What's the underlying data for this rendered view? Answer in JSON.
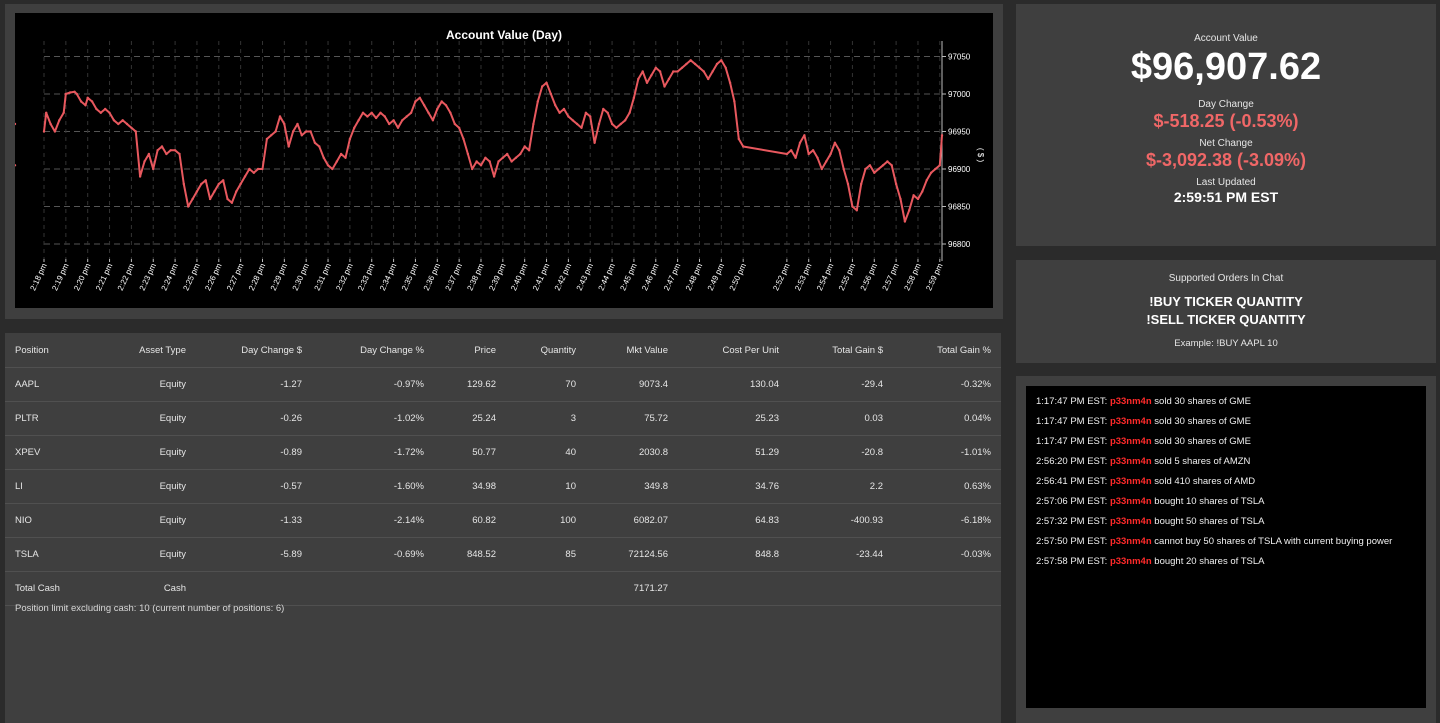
{
  "chart": {
    "title": "Account Value (Day)",
    "y_axis_label": "( $ )"
  },
  "chart_data": {
    "type": "line",
    "title": "Account Value (Day)",
    "ylabel": "( $ )",
    "ylim": [
      96780,
      97060
    ],
    "yticks": [
      96800,
      96850,
      96900,
      96950,
      97000,
      97050
    ],
    "x_tick_labels": [
      "2:18 pm",
      "2:19 pm",
      "2:20 pm",
      "2:21 pm",
      "2:22 pm",
      "2:23 pm",
      "2:24 pm",
      "2:25 pm",
      "2:26 pm",
      "2:27 pm",
      "2:28 pm",
      "2:29 pm",
      "2:30 pm",
      "2:31 pm",
      "2:32 pm",
      "2:33 pm",
      "2:34 pm",
      "2:35 pm",
      "2:36 pm",
      "2:37 pm",
      "2:38 pm",
      "2:39 pm",
      "2:40 pm",
      "2:41 pm",
      "2:42 pm",
      "2:43 pm",
      "2:44 pm",
      "2:45 pm",
      "2:46 pm",
      "2:47 pm",
      "2:48 pm",
      "2:49 pm",
      "2:50 pm",
      "2:52 pm",
      "2:53 pm",
      "2:54 pm",
      "2:55 pm",
      "2:56 pm",
      "2:57 pm",
      "2:58 pm",
      "2:59 pm"
    ],
    "x_tick_minutes": [
      18,
      19,
      20,
      21,
      22,
      23,
      24,
      25,
      26,
      27,
      28,
      29,
      30,
      31,
      32,
      33,
      34,
      35,
      36,
      37,
      38,
      39,
      40,
      41,
      42,
      43,
      44,
      45,
      46,
      47,
      48,
      49,
      50,
      52,
      53,
      54,
      55,
      56,
      57,
      58,
      59
    ],
    "x_minutes": [
      18.0,
      18.1,
      18.3,
      18.5,
      18.7,
      18.9,
      19.0,
      19.2,
      19.4,
      19.5,
      19.7,
      19.9,
      20.0,
      20.2,
      20.4,
      20.6,
      20.8,
      21.0,
      21.2,
      21.4,
      21.6,
      21.8,
      22.0,
      22.2,
      22.4,
      22.6,
      22.8,
      23.0,
      23.2,
      23.4,
      23.6,
      23.8,
      24.0,
      24.2,
      24.4,
      24.6,
      24.8,
      25.0,
      25.2,
      25.4,
      25.6,
      25.8,
      26.0,
      26.2,
      26.4,
      26.6,
      26.8,
      27.0,
      27.2,
      27.4,
      27.6,
      27.8,
      28.0,
      28.2,
      28.4,
      28.6,
      28.8,
      29.0,
      29.2,
      29.4,
      29.6,
      29.8,
      30.0,
      30.2,
      30.4,
      30.6,
      30.8,
      31.0,
      31.2,
      31.4,
      31.6,
      31.8,
      32.0,
      32.2,
      32.4,
      32.6,
      32.8,
      33.0,
      33.2,
      33.4,
      33.6,
      33.8,
      34.0,
      34.2,
      34.4,
      34.6,
      34.8,
      35.0,
      35.2,
      35.4,
      35.6,
      35.8,
      36.0,
      36.2,
      36.4,
      36.6,
      36.8,
      37.0,
      37.2,
      37.4,
      37.6,
      37.8,
      38.0,
      38.2,
      38.4,
      38.6,
      38.8,
      39.0,
      39.2,
      39.4,
      39.6,
      39.8,
      40.0,
      40.2,
      40.4,
      40.6,
      40.8,
      41.0,
      41.2,
      41.4,
      41.6,
      41.8,
      42.0,
      42.2,
      42.4,
      42.6,
      42.8,
      43.0,
      43.2,
      43.4,
      43.6,
      43.8,
      44.0,
      44.2,
      44.4,
      44.6,
      44.8,
      45.0,
      45.2,
      45.4,
      45.6,
      45.8,
      46.0,
      46.2,
      46.4,
      46.6,
      46.8,
      47.0,
      47.2,
      47.4,
      47.6,
      47.8,
      48.0,
      48.2,
      48.4,
      48.6,
      48.8,
      49.0,
      49.2,
      49.4,
      49.6,
      49.8,
      50.0,
      52.0,
      52.2,
      52.4,
      52.6,
      52.8,
      53.0,
      53.2,
      53.4,
      53.6,
      53.8,
      54.0,
      54.2,
      54.4,
      54.6,
      54.8,
      55.0,
      55.2,
      55.4,
      55.6,
      55.8,
      56.0,
      56.2,
      56.4,
      56.6,
      56.8,
      57.0,
      57.2,
      57.4,
      57.6,
      57.8,
      58.0,
      58.2,
      58.4,
      58.6,
      58.8,
      59.0,
      59.1
    ],
    "values": [
      96950,
      96975,
      96960,
      96950,
      96965,
      96975,
      97000,
      97002,
      97003,
      97000,
      96990,
      96985,
      96995,
      96990,
      96980,
      96975,
      96980,
      96975,
      96965,
      96960,
      96965,
      96960,
      96955,
      96950,
      96890,
      96910,
      96920,
      96900,
      96925,
      96930,
      96920,
      96925,
      96925,
      96920,
      96880,
      96850,
      96860,
      96870,
      96880,
      96885,
      96860,
      96870,
      96880,
      96885,
      96860,
      96855,
      96870,
      96880,
      96890,
      96900,
      96895,
      96900,
      96900,
      96940,
      96945,
      96950,
      96970,
      96960,
      96930,
      96950,
      96960,
      96945,
      96950,
      96950,
      96935,
      96930,
      96915,
      96905,
      96900,
      96910,
      96920,
      96915,
      96940,
      96955,
      96965,
      96975,
      96970,
      96975,
      96968,
      96975,
      96970,
      96960,
      96965,
      96955,
      96965,
      96970,
      96975,
      96990,
      96995,
      96985,
      96975,
      96965,
      96980,
      96990,
      96985,
      96975,
      96960,
      96955,
      96940,
      96920,
      96900,
      96910,
      96905,
      96915,
      96910,
      96890,
      96910,
      96915,
      96920,
      96910,
      96915,
      96920,
      96930,
      96925,
      96960,
      96990,
      97010,
      97015,
      97000,
      96985,
      96975,
      96980,
      96970,
      96965,
      96960,
      96955,
      96975,
      96970,
      96935,
      96960,
      96980,
      96975,
      96960,
      96955,
      96960,
      96965,
      96975,
      96995,
      97020,
      97030,
      97015,
      97025,
      97035,
      97030,
      97010,
      97020,
      97030,
      97030,
      97035,
      97040,
      97045,
      97040,
      97035,
      97030,
      97020,
      97030,
      97040,
      97045,
      97035,
      97015,
      96990,
      96940,
      96930,
      96920,
      96925,
      96915,
      96935,
      96945,
      96920,
      96925,
      96915,
      96900,
      96910,
      96920,
      96935,
      96925,
      96900,
      96880,
      96850,
      96845,
      96880,
      96900,
      96905,
      96895,
      96900,
      96905,
      96910,
      96905,
      96880,
      96860,
      96830,
      96845,
      96865,
      96860,
      96870,
      96885,
      96895,
      96900,
      96905,
      96945,
      96960,
      96905
    ],
    "grid": true,
    "legend": "none"
  },
  "summary": {
    "account_value_label": "Account Value",
    "account_value": "$96,907.62",
    "day_change_label": "Day Change",
    "day_change": "$-518.25 (-0.53%)",
    "net_change_label": "Net Change",
    "net_change": "$-3,092.38 (-3.09%)",
    "last_updated_label": "Last Updated",
    "last_updated": "2:59:51 PM EST"
  },
  "orders": {
    "title": "Supported Orders In Chat",
    "buy": "!BUY TICKER QUANTITY",
    "sell": "!SELL TICKER QUANTITY",
    "example": "Example: !BUY AAPL 10"
  },
  "table": {
    "headers": [
      "Position",
      "Asset Type",
      "Day Change $",
      "Day Change %",
      "Price",
      "Quantity",
      "Mkt Value",
      "Cost Per Unit",
      "Total Gain $",
      "Total Gain %"
    ],
    "rows": [
      {
        "position": "AAPL",
        "type": "Equity",
        "day_change": "-1.27",
        "day_change_pct": "-0.97%",
        "price": "129.62",
        "qty": "70",
        "mkt": "9073.4",
        "cost": "130.04",
        "gain": "-29.4",
        "gain_pct": "-0.32%",
        "day_neg": true,
        "gain_neg": true
      },
      {
        "position": "PLTR",
        "type": "Equity",
        "day_change": "-0.26",
        "day_change_pct": "-1.02%",
        "price": "25.24",
        "qty": "3",
        "mkt": "75.72",
        "cost": "25.23",
        "gain": "0.03",
        "gain_pct": "0.04%",
        "day_neg": true,
        "gain_neg": false
      },
      {
        "position": "XPEV",
        "type": "Equity",
        "day_change": "-0.89",
        "day_change_pct": "-1.72%",
        "price": "50.77",
        "qty": "40",
        "mkt": "2030.8",
        "cost": "51.29",
        "gain": "-20.8",
        "gain_pct": "-1.01%",
        "day_neg": true,
        "gain_neg": true
      },
      {
        "position": "LI",
        "type": "Equity",
        "day_change": "-0.57",
        "day_change_pct": "-1.60%",
        "price": "34.98",
        "qty": "10",
        "mkt": "349.8",
        "cost": "34.76",
        "gain": "2.2",
        "gain_pct": "0.63%",
        "day_neg": true,
        "gain_neg": false
      },
      {
        "position": "NIO",
        "type": "Equity",
        "day_change": "-1.33",
        "day_change_pct": "-2.14%",
        "price": "60.82",
        "qty": "100",
        "mkt": "6082.07",
        "cost": "64.83",
        "gain": "-400.93",
        "gain_pct": "-6.18%",
        "day_neg": true,
        "gain_neg": true
      },
      {
        "position": "TSLA",
        "type": "Equity",
        "day_change": "-5.89",
        "day_change_pct": "-0.69%",
        "price": "848.52",
        "qty": "85",
        "mkt": "72124.56",
        "cost": "848.8",
        "gain": "-23.44",
        "gain_pct": "-0.03%",
        "day_neg": true,
        "gain_neg": true
      }
    ],
    "cash_row": {
      "position": "Total Cash",
      "type": "Cash",
      "mkt": "7171.27"
    },
    "footnote": "Position limit excluding cash: 10 (current number of positions: 6)"
  },
  "log": [
    {
      "time": "1:17:47 PM EST:",
      "user": "p33nm4n",
      "text": "sold 30 shares of GME"
    },
    {
      "time": "1:17:47 PM EST:",
      "user": "p33nm4n",
      "text": "sold 30 shares of GME"
    },
    {
      "time": "1:17:47 PM EST:",
      "user": "p33nm4n",
      "text": "sold 30 shares of GME"
    },
    {
      "time": "2:56:20 PM EST:",
      "user": "p33nm4n",
      "text": "sold 5 shares of AMZN"
    },
    {
      "time": "2:56:41 PM EST:",
      "user": "p33nm4n",
      "text": "sold 410 shares of AMD"
    },
    {
      "time": "2:57:06 PM EST:",
      "user": "p33nm4n",
      "text": "bought 10 shares of TSLA"
    },
    {
      "time": "2:57:32 PM EST:",
      "user": "p33nm4n",
      "text": "bought 50 shares of TSLA"
    },
    {
      "time": "2:57:50 PM EST:",
      "user": "p33nm4n",
      "text": "cannot buy 50 shares of TSLA with current buying power"
    },
    {
      "time": "2:57:58 PM EST:",
      "user": "p33nm4n",
      "text": "bought 20 shares of TSLA"
    }
  ],
  "colors": {
    "line": "#e8585e",
    "negative": "#f06767",
    "positive": "#7ce07c",
    "username": "#ff2a2a",
    "panel": "#3f3f3f",
    "background": "#2b2b2b"
  }
}
